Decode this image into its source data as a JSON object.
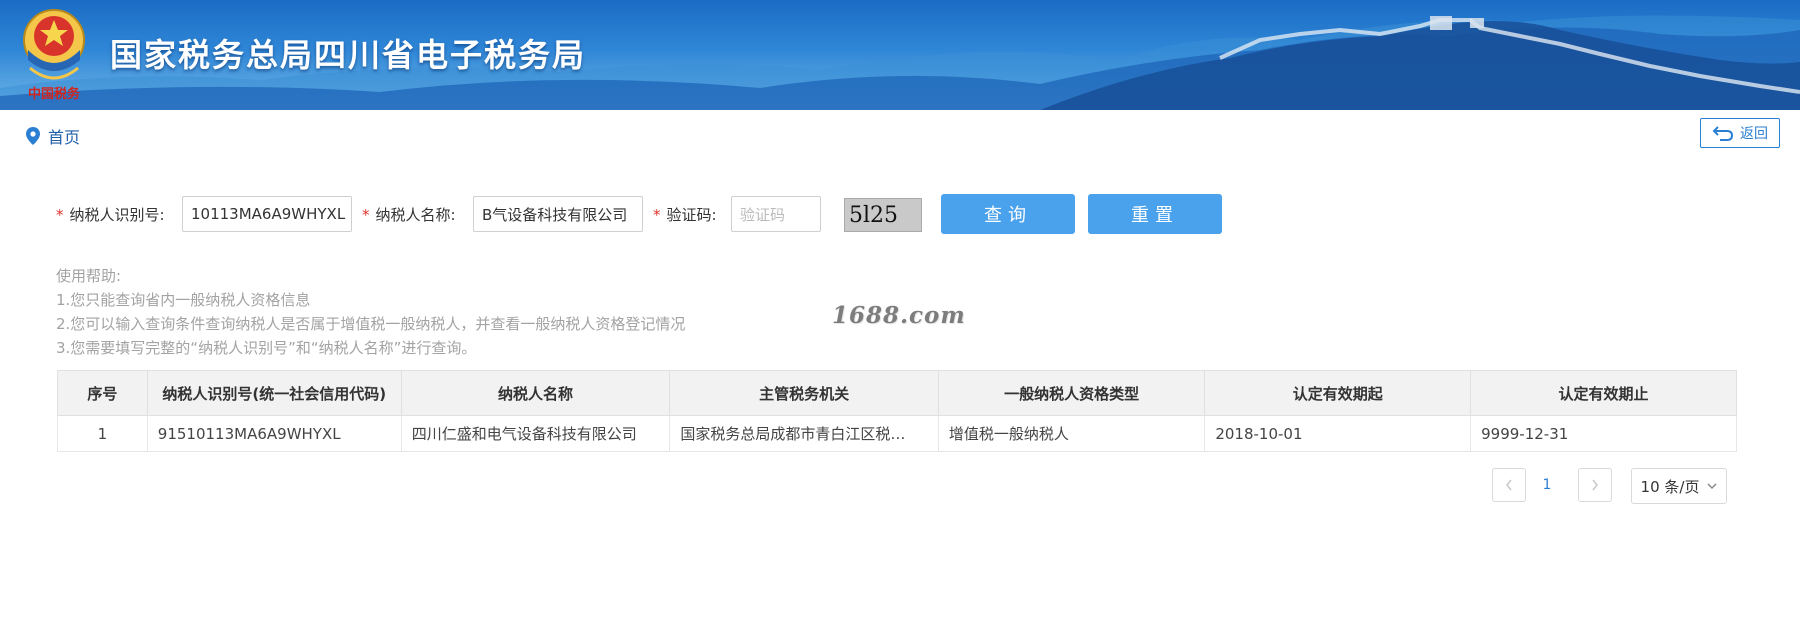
{
  "header": {
    "site_title": "国家税务总局四川省电子税务局",
    "emblem_caption": "中国税务"
  },
  "breadcrumb": {
    "home_label": "首页"
  },
  "back_button": {
    "label": "返回"
  },
  "form": {
    "taxpayer_id": {
      "label": "纳税人识别号:",
      "value": "10113MA6A9WHYXL"
    },
    "taxpayer_name": {
      "label": "纳税人名称:",
      "value": "B气设备科技有限公司"
    },
    "captcha": {
      "label": "验证码:",
      "placeholder": "验证码",
      "image_text": "5l25"
    },
    "query_label": "查询",
    "reset_label": "重置"
  },
  "help": {
    "title": "使用帮助:",
    "lines": [
      "1.您只能查询省内一般纳税人资格信息",
      "2.您可以输入查询条件查询纳税人是否属于增值税一般纳税人，并查看一般纳税人资格登记情况",
      "3.您需要填写完整的“纳税人识别号”和“纳税人名称”进行查询。"
    ]
  },
  "watermark": "1688.com",
  "table": {
    "columns": [
      "序号",
      "纳税人识别号(统一社会信用代码)",
      "纳税人名称",
      "主管税务机关",
      "一般纳税人资格类型",
      "认定有效期起",
      "认定有效期止"
    ],
    "rows": [
      [
        "1",
        "91510113MA6A9WHYXL",
        "四川仁盛和电气设备科技有限公司",
        "国家税务总局成都市青白江区税…",
        "增值税一般纳税人",
        "2018-10-01",
        "9999-12-31"
      ]
    ]
  },
  "pagination": {
    "current_page": "1",
    "page_size_label": "10 条/页"
  },
  "colors": {
    "accent": "#4aa2ec",
    "link": "#2b7fd3",
    "required": "#e0322c"
  }
}
